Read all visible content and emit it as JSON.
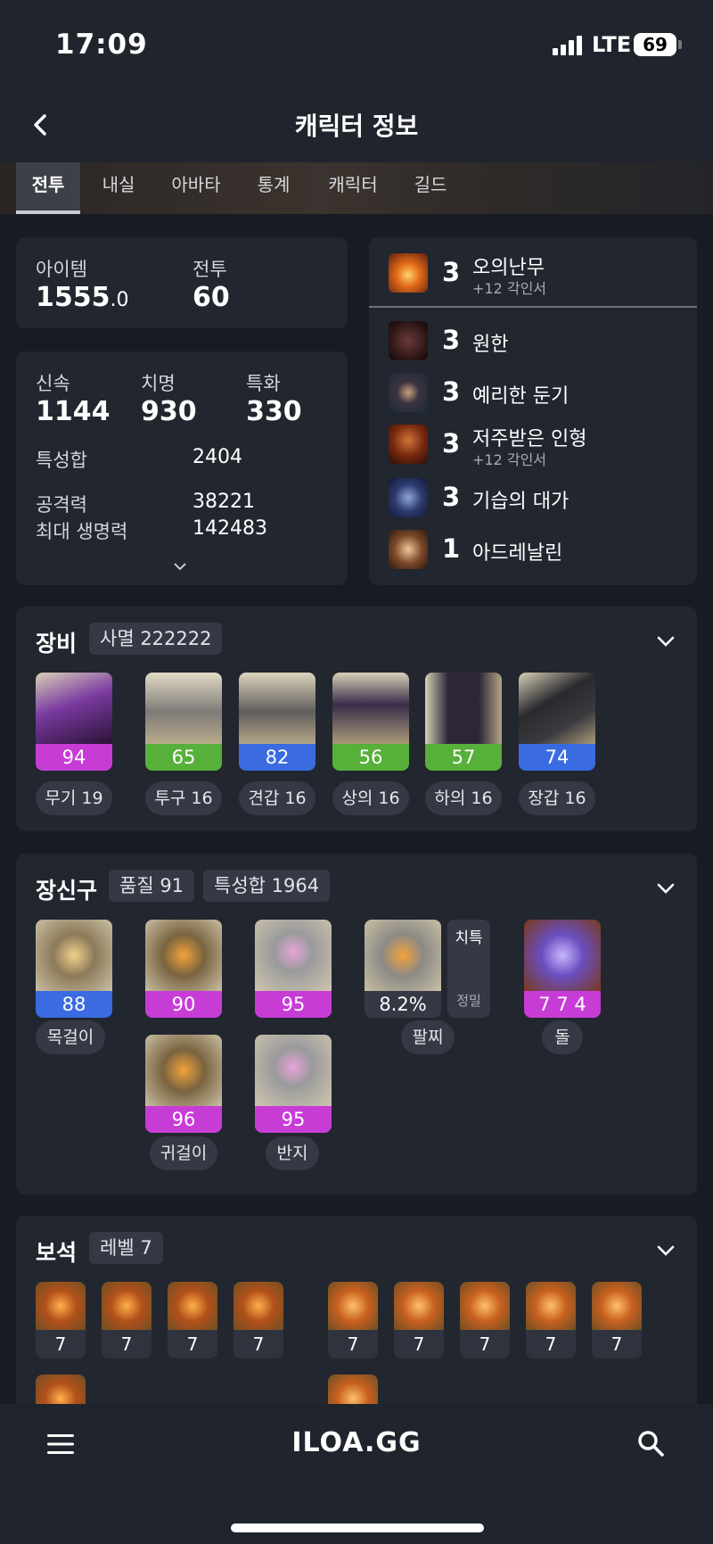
{
  "status_bar": {
    "time": "17:09",
    "network": "LTE",
    "battery": "69"
  },
  "header": {
    "title": "캐릭터 정보"
  },
  "tabs": [
    "전투",
    "내실",
    "아바타",
    "통계",
    "캐릭터",
    "길드"
  ],
  "summary": {
    "item_label": "아이템",
    "item_value": "1555",
    "item_decimal": ".0",
    "combat_label": "전투",
    "combat_value": "60"
  },
  "stats": {
    "speed_label": "신속",
    "speed_value": "1144",
    "crit_label": "치명",
    "crit_value": "930",
    "spec_label": "특화",
    "spec_value": "330",
    "total_label": "특성합",
    "total_value": "2404",
    "attack_label": "공격력",
    "attack_value": "38221",
    "hp_label": "최대 생명력",
    "hp_value": "142483"
  },
  "engravings": [
    {
      "level": "3",
      "name": "오의난무",
      "sub": "+12 각인서"
    },
    {
      "level": "3",
      "name": "원한",
      "sub": ""
    },
    {
      "level": "3",
      "name": "예리한 둔기",
      "sub": ""
    },
    {
      "level": "3",
      "name": "저주받은 인형",
      "sub": "+12 각인서"
    },
    {
      "level": "3",
      "name": "기습의 대가",
      "sub": ""
    },
    {
      "level": "1",
      "name": "아드레날린",
      "sub": ""
    }
  ],
  "equipment": {
    "title": "장비",
    "set": "사멸 222222",
    "items": [
      {
        "quality": "94",
        "quality_color": "#c83cd6",
        "name": "무기 19"
      },
      {
        "quality": "65",
        "quality_color": "#56b03a",
        "name": "투구 16"
      },
      {
        "quality": "82",
        "quality_color": "#3a6be0",
        "name": "견갑 16"
      },
      {
        "quality": "56",
        "quality_color": "#56b03a",
        "name": "상의 16"
      },
      {
        "quality": "57",
        "quality_color": "#56b03a",
        "name": "하의 16"
      },
      {
        "quality": "74",
        "quality_color": "#3a6be0",
        "name": "장갑 16"
      }
    ]
  },
  "accessories": {
    "title": "장신구",
    "quality": "품질 91",
    "stat_total": "특성합 1964",
    "necklace": {
      "quality": "88",
      "name": "목걸이"
    },
    "earring1": {
      "quality": "90"
    },
    "earring2": {
      "quality": "96",
      "name": "귀걸이"
    },
    "ring1": {
      "quality": "95"
    },
    "ring2": {
      "quality": "95",
      "name": "반지"
    },
    "bracelet": {
      "value": "8.2%",
      "tag1": "치특",
      "tag2": "정밀",
      "name": "팔찌"
    },
    "stone": {
      "value": "7 7 4",
      "name": "돌"
    },
    "colors": {
      "purple": "#c83cd6",
      "blue": "#3a6be0"
    }
  },
  "gems": {
    "title": "보석",
    "level": "레벨 7",
    "values": [
      "7",
      "7",
      "7",
      "7",
      "7",
      "7",
      "7",
      "7",
      "7"
    ]
  },
  "bottom_nav": {
    "logo": "ILOA.GG"
  }
}
